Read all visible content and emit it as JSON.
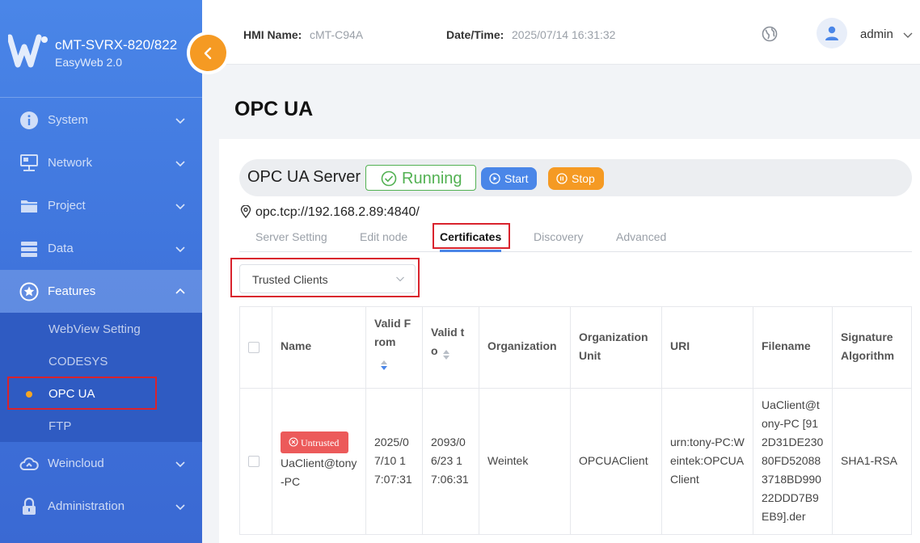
{
  "brand": {
    "title": "cMT-SVRX-820/822",
    "subtitle": "EasyWeb 2.0"
  },
  "header": {
    "hmi_label": "HMI Name:",
    "hmi_value": "cMT-C94A",
    "datetime_label": "Date/Time:",
    "datetime_value": "2025/07/14 16:31:32",
    "user": "admin"
  },
  "sidebar": {
    "items": [
      {
        "label": "System"
      },
      {
        "label": "Network"
      },
      {
        "label": "Project"
      },
      {
        "label": "Data"
      },
      {
        "label": "Features"
      },
      {
        "label": "Weincloud"
      },
      {
        "label": "Administration"
      }
    ],
    "features_sub": [
      {
        "label": "WebView Setting"
      },
      {
        "label": "CODESYS"
      },
      {
        "label": "OPC UA"
      },
      {
        "label": "FTP"
      }
    ]
  },
  "page": {
    "title": "OPC UA"
  },
  "server": {
    "title": "OPC UA Server",
    "status": "Running",
    "start_label": "Start",
    "stop_label": "Stop",
    "endpoint": "opc.tcp://192.168.2.89:4840/"
  },
  "tabs": [
    {
      "label": "Server Setting"
    },
    {
      "label": "Edit node"
    },
    {
      "label": "Certificates"
    },
    {
      "label": "Discovery"
    },
    {
      "label": "Advanced"
    }
  ],
  "filter": {
    "selected": "Trusted Clients"
  },
  "table": {
    "headers": {
      "name": "Name",
      "valid_from": [
        "Valid F",
        "rom"
      ],
      "valid_to": [
        "Valid t",
        "o"
      ],
      "organization": "Organization",
      "org_unit": [
        "Organization",
        "Unit"
      ],
      "uri": "URI",
      "filename": "Filename",
      "sig_alg": [
        "Signature",
        "Algorithm"
      ]
    },
    "rows": [
      {
        "badge": "Untrusted",
        "name": [
          "UaClient@tony",
          "-PC"
        ],
        "valid_from": [
          "2025/0",
          "7/10 1",
          "7:07:31"
        ],
        "valid_to": [
          "2093/0",
          "6/23 1",
          "7:06:31"
        ],
        "organization": "Weintek",
        "org_unit": "OPCUAClient",
        "uri": [
          "urn:tony-PC:W",
          "eintek:OPCUA",
          "Client"
        ],
        "filename": [
          "UaClient@t",
          "ony-PC [91",
          "2D31DE230",
          "80FD52088",
          "3718BD990",
          "22DDD7B9",
          "EB9].der"
        ],
        "sig_alg": "SHA1-RSA"
      }
    ]
  },
  "colors": {
    "sidebar": "#4a86e8",
    "accent_blue": "#4a86e8",
    "accent_orange": "#f59a23",
    "running_green": "#52b152",
    "untrusted_red": "#ec5a5a",
    "highlight_red": "#d9232d"
  }
}
